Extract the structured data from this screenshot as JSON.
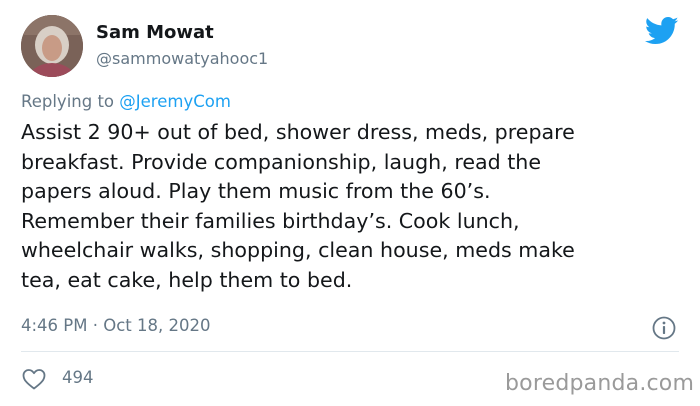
{
  "tweet": {
    "author_name": "Sam Mowat",
    "author_handle": "@sammowatyahooc1",
    "replying_prefix": "Replying to ",
    "replying_to": "@JeremyCom",
    "text": "Assist 2 90+ out of bed, shower dress, meds, prepare\nbreakfast. Provide companionship, laugh, read the\npapers aloud. Play them music from the 60’s.\nRemember their families birthday’s. Cook lunch,\nwheelchair walks, shopping, clean house, meds make\ntea, eat cake, help them to bed.",
    "timestamp": "4:46 PM · Oct 18, 2020",
    "like_count": "494"
  },
  "watermark": "boredpanda.com",
  "colors": {
    "twitter_blue": "#1da1f2",
    "muted_text": "#657786",
    "divider": "#e1e8ed"
  },
  "icons": {
    "brand": "twitter-bird-icon",
    "info": "info-icon",
    "like": "heart-icon"
  }
}
